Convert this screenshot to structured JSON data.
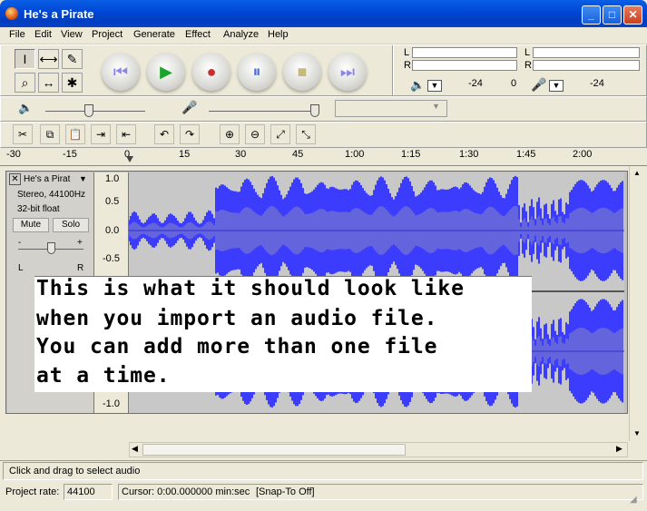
{
  "window": {
    "title": "He's a Pirate",
    "buttons": {
      "minimize": "_",
      "maximize": "□",
      "close": "✕"
    }
  },
  "menu": [
    "File",
    "Edit",
    "View",
    "Project",
    "Generate",
    "Effect",
    "Analyze",
    "Help"
  ],
  "tools": {
    "selection": "I",
    "envelope": "⟷",
    "draw": "✎",
    "zoom": "⌕",
    "timeshift": "↔",
    "multi": "✱"
  },
  "transport": {
    "rewind": "⏮",
    "play": "▶",
    "record": "●",
    "pause": "⏸",
    "stop": "■",
    "forward": "⏭"
  },
  "meters": {
    "play": {
      "L": "L",
      "R": "R",
      "scale": [
        "-24",
        "0"
      ]
    },
    "record": {
      "L": "L",
      "R": "R",
      "scale": [
        "-24",
        "0"
      ]
    }
  },
  "edit_tools": [
    "✂",
    "⧉",
    "📋",
    "⇥",
    "⇤",
    "↶",
    "↷",
    "⊕",
    "⊖",
    "⤢",
    "⤡"
  ],
  "ruler": [
    "-30",
    "-15",
    "0",
    "15",
    "30",
    "45",
    "1:00",
    "1:15",
    "1:30",
    "1:45",
    "2:00"
  ],
  "track": {
    "name": "He's a Pirat",
    "info1": "Stereo, 44100Hz",
    "info2": "32-bit float",
    "mute": "Mute",
    "solo": "Solo",
    "gain_minus": "-",
    "gain_plus": "+",
    "pan_L": "L",
    "pan_R": "R"
  },
  "vscale": [
    "1.0",
    "0.5",
    "0.0",
    "-0.5",
    "-1.0"
  ],
  "overlay": [
    "This is what it should look like",
    "when you import an audio file.",
    "You can add more than one file",
    "at a time."
  ],
  "status": {
    "hint": "Click and drag to select audio",
    "rate_label": "Project rate:",
    "rate_value": "44100",
    "cursor": "Cursor: 0:00.000000 min:sec",
    "snap": "[Snap-To Off]"
  },
  "colors": {
    "wave_outer": "#3c3cff",
    "wave_inner": "#6464dc",
    "title_bar": "#0049d6"
  }
}
